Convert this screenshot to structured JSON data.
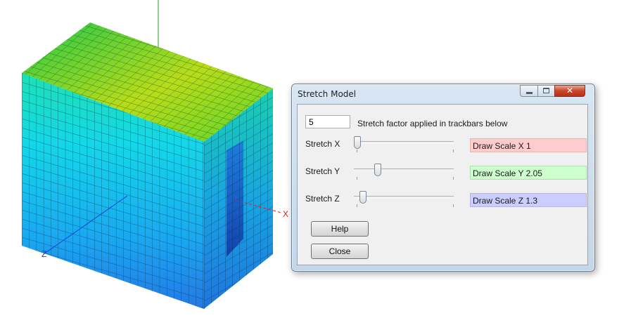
{
  "axes": {
    "x_label": "X",
    "z_label": "Z"
  },
  "colors": {
    "mesh_top": "#5fd42a",
    "mesh_bottom": "#2a7fe8",
    "axis_x": "#e02020",
    "axis_y": "#1fa01f",
    "axis_z": "#2040d0"
  },
  "dialog": {
    "title": "Stretch Model",
    "stretch_factor_value": "5",
    "stretch_factor_label": "Stretch factor applied in trackbars below",
    "trackbars": [
      {
        "label": "Stretch X",
        "position": 0.0,
        "scale_text": "Draw Scale X  1"
      },
      {
        "label": "Stretch Y",
        "position": 0.22,
        "scale_text": "Draw Scale Y  2.05"
      },
      {
        "label": "Stretch Z",
        "position": 0.06,
        "scale_text": "Draw Scale Z  1.3"
      }
    ],
    "help_label": "Help",
    "close_label": "Close"
  }
}
